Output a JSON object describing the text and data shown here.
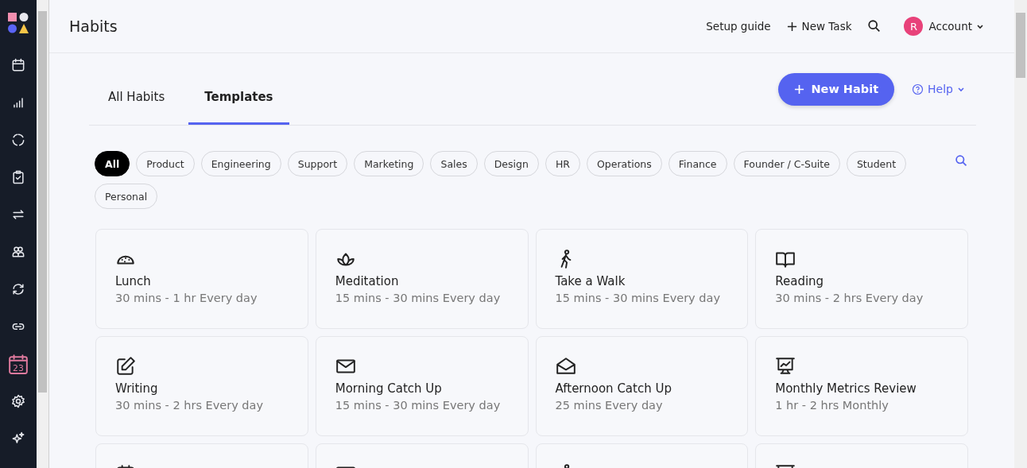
{
  "sidebar": {
    "items": [
      {
        "kind": "calendar",
        "selected": false
      },
      {
        "kind": "bars",
        "selected": false
      },
      {
        "kind": "ring",
        "selected": false
      },
      {
        "kind": "clipboard",
        "selected": false
      },
      {
        "kind": "repeat",
        "selected": false
      },
      {
        "kind": "people",
        "selected": false
      },
      {
        "kind": "sync",
        "selected": false
      },
      {
        "kind": "link",
        "selected": false
      },
      {
        "kind": "day",
        "selected": true,
        "day": "23"
      },
      {
        "kind": "gear",
        "selected": false
      },
      {
        "kind": "sparkles",
        "selected": false
      }
    ]
  },
  "header": {
    "title": "Habits",
    "setup_guide": "Setup guide",
    "new_task": "New Task",
    "account": {
      "initial": "R",
      "label": "Account"
    }
  },
  "tabs": [
    {
      "label": "All Habits",
      "selected": false
    },
    {
      "label": "Templates",
      "selected": true
    }
  ],
  "new_habit_button": "New Habit",
  "help": "Help",
  "filters": [
    {
      "label": "All",
      "selected": true
    },
    {
      "label": "Product",
      "selected": false
    },
    {
      "label": "Engineering",
      "selected": false
    },
    {
      "label": "Support",
      "selected": false
    },
    {
      "label": "Marketing",
      "selected": false
    },
    {
      "label": "Sales",
      "selected": false
    },
    {
      "label": "Design",
      "selected": false
    },
    {
      "label": "HR",
      "selected": false
    },
    {
      "label": "Operations",
      "selected": false
    },
    {
      "label": "Finance",
      "selected": false
    },
    {
      "label": "Founder / C-Suite",
      "selected": false
    },
    {
      "label": "Student",
      "selected": false
    },
    {
      "label": "Personal",
      "selected": false
    }
  ],
  "templates": [
    {
      "kind": "taco",
      "title": "Lunch",
      "subtitle": "30 mins - 1 hr Every day"
    },
    {
      "kind": "lotus",
      "title": "Meditation",
      "subtitle": "15 mins - 30 mins Every day"
    },
    {
      "kind": "walker",
      "title": "Take a Walk",
      "subtitle": "15 mins - 30 mins Every day"
    },
    {
      "kind": "book",
      "title": "Reading",
      "subtitle": "30 mins - 2 hrs Every day"
    },
    {
      "kind": "pencil",
      "title": "Writing",
      "subtitle": "30 mins - 2 hrs Every day"
    },
    {
      "kind": "envelope",
      "title": "Morning Catch Up",
      "subtitle": "15 mins - 30 mins Every day"
    },
    {
      "kind": "opened",
      "title": "Afternoon Catch Up",
      "subtitle": "25 mins Every day"
    },
    {
      "kind": "presentation",
      "title": "Monthly Metrics Review",
      "subtitle": "1 hr - 2 hrs Monthly"
    },
    {
      "kind": "calendar"
    },
    {
      "kind": "envelope"
    },
    {
      "kind": "walker"
    },
    {
      "kind": "presentation"
    }
  ]
}
